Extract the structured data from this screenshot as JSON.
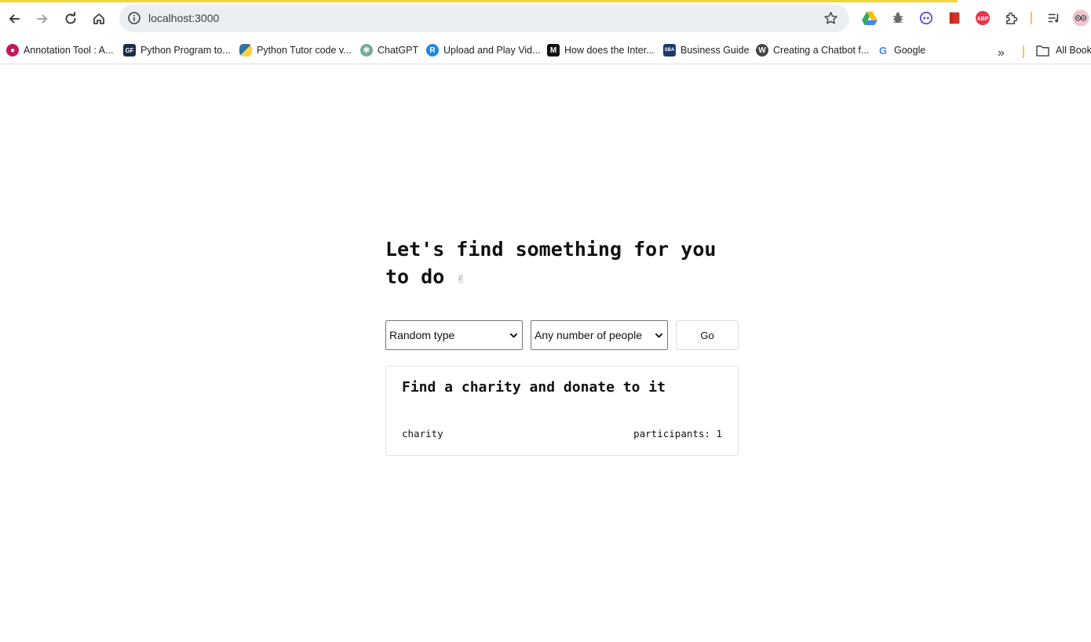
{
  "browser": {
    "url": "localhost:3000",
    "bookmarks": [
      {
        "label": "Annotation Tool : A...",
        "icon": "annotation-tool-icon",
        "color": "#c2185b"
      },
      {
        "label": "Python Program to...",
        "icon": "python-program-icon",
        "color": "#1a2b4c"
      },
      {
        "label": "Python Tutor code v...",
        "icon": "python-logo-icon",
        "color": "#3572a5"
      },
      {
        "label": "ChatGPT",
        "icon": "chatgpt-icon",
        "color": "#74aa9c"
      },
      {
        "label": "Upload and Play Vid...",
        "icon": "r-logo-icon",
        "color": "#1e88e5"
      },
      {
        "label": "How does the Inter...",
        "icon": "medium-icon",
        "color": "#111111"
      },
      {
        "label": "Business Guide",
        "icon": "sba-icon",
        "color": "#1b3a6b"
      },
      {
        "label": "Creating a Chatbot f...",
        "icon": "wordpress-icon",
        "color": "#444444"
      },
      {
        "label": "Google",
        "icon": "google-icon",
        "color": "#4285f4"
      }
    ],
    "all_bookmarks_label": "All Bookmarks"
  },
  "page": {
    "heading": "Let's find something for you to do",
    "heading_emoji": "✌",
    "type_select": "Random type",
    "people_select": "Any number of people",
    "go_label": "Go",
    "activity": {
      "title": "Find a charity and donate to it",
      "type": "charity",
      "participants": "participants: 1"
    }
  }
}
